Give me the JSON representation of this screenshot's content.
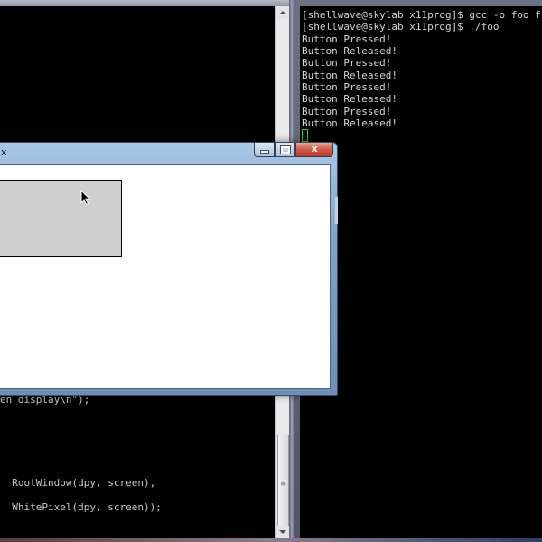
{
  "left_terminal": {
    "code_lines": [
      "en display\\n\");",
      "  RootWindow(dpy, screen),",
      "  WhitePixel(dpy, screen));"
    ],
    "scroll_grip": "≡"
  },
  "right_terminal": {
    "lines": [
      "[shellwave@skylab x11prog]$ gcc -o foo f",
      "[shellwave@skylab x11prog]$ ./foo",
      "Button Pressed!",
      "Button Released!",
      "Button Pressed!",
      "Button Released!",
      "Button Pressed!",
      "Button Released!",
      "Button Pressed!",
      "Button Released!"
    ]
  },
  "x_window": {
    "title": "x",
    "close_glyph": "x",
    "rect_fill": "#cfcfcf"
  },
  "colors": {
    "terminal_bg": "#000000",
    "terminal_text": "#d4d4d4",
    "cursor": "#2ed12e",
    "title_gradient_top": "#a9c7e6",
    "close_button": "#cf5a45"
  }
}
